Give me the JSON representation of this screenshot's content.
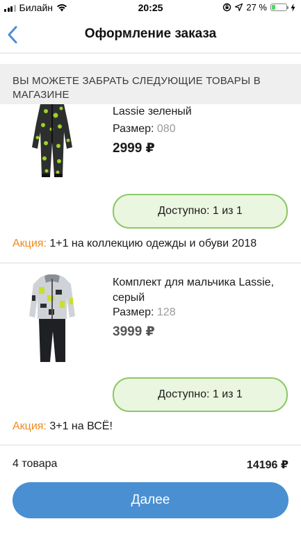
{
  "status_bar": {
    "carrier": "Билайн",
    "time": "20:25",
    "battery_percent": "27 %",
    "battery_level": 0.27
  },
  "nav": {
    "title": "Оформление заказа"
  },
  "section": {
    "header": "ВЫ МОЖЕТЕ ЗАБРАТЬ СЛЕДУЮЩИЕ ТОВАРЫ В МАГАЗИНЕ"
  },
  "products": [
    {
      "name": "Lassie зеленый",
      "size_label": "Размер:",
      "size_value": "080",
      "price": "2999 ₽",
      "availability": "Доступно: 1 из 1",
      "promo_label": "Акция:",
      "promo_text": "1+1 на коллекцию одежды и обуви 2018"
    },
    {
      "name": "Комплект для мальчика Lassie, серый",
      "size_label": "Размер:",
      "size_value": "128",
      "price": "3999 ₽",
      "availability": "Доступно: 1 из 1",
      "promo_label": "Акция:",
      "promo_text": "3+1 на ВСЁ!"
    }
  ],
  "footer": {
    "count": "4 товара",
    "total": "14196 ₽",
    "next_label": "Далее"
  },
  "colors": {
    "accent_blue": "#4a8fd2",
    "available_border": "#8cc865",
    "available_bg": "#eaf6e0",
    "promo_orange": "#ef8a1e"
  },
  "icons": {
    "back": "chevron-left-icon",
    "wifi": "wifi-icon",
    "location": "location-arrow-icon",
    "rotation_lock": "rotation-lock-icon",
    "charging": "lightning-icon"
  }
}
